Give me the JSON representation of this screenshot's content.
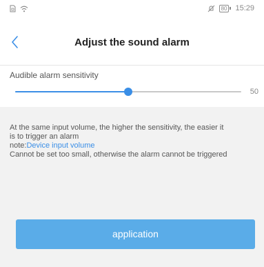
{
  "status_bar": {
    "time": "15:29",
    "battery": "80"
  },
  "header": {
    "title": "Adjust the sound alarm"
  },
  "sensitivity": {
    "label": "Audible alarm sensitivity",
    "value": "50",
    "level_fraction": 0.5,
    "accent_color": "#3a8ee6"
  },
  "description": {
    "line1": "At the same input volume, the higher the sensitivity, the easier it",
    "line2": "is to trigger an alarm",
    "note_prefix": "note:",
    "note_link": "Device input volume",
    "line4": "Cannot be set too small, otherwise the alarm cannot be triggered"
  },
  "button": {
    "label": "application",
    "color": "#5aace8"
  },
  "icons": {
    "status_left": [
      "sim-icon",
      "wifi-icon"
    ],
    "status_right": [
      "mute-icon",
      "battery-icon"
    ],
    "back": "back-chevron-icon"
  }
}
